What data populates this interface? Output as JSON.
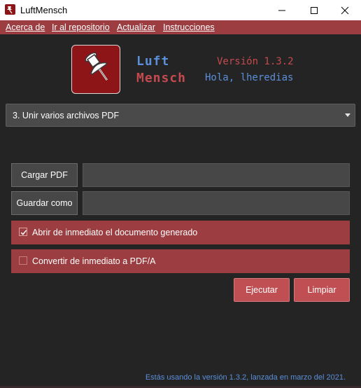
{
  "window": {
    "title": "LuftMensch"
  },
  "menu": {
    "items": [
      "Acerca de",
      "Ir al repositorio",
      "Actualizar",
      "Instrucciones"
    ]
  },
  "header": {
    "brand_line1": "Luft",
    "brand_line2": "Mensch",
    "version": "Versión 1.3.2",
    "greeting": "Hola, lheredias"
  },
  "task_select": {
    "selected": "3. Unir varios archivos PDF"
  },
  "buttons": {
    "load_pdf": "Cargar PDF",
    "save_as": "Guardar como",
    "execute": "Ejecutar",
    "clear": "Limpiar"
  },
  "inputs": {
    "load_pdf_path": "",
    "save_as_path": ""
  },
  "options": [
    {
      "label": "Abrir de inmediato el documento generado",
      "checked": true
    },
    {
      "label": "Convertir de inmediato a PDF/A",
      "checked": false
    }
  ],
  "footer": "Estás usando la versión 1.3.2, lanzada en marzo del 2021.",
  "colors": {
    "accent": "#9b3d41",
    "button_red": "#c04f53",
    "brand_blue": "#5b8fd9",
    "brand_red": "#c44a4f",
    "background": "#242424"
  }
}
